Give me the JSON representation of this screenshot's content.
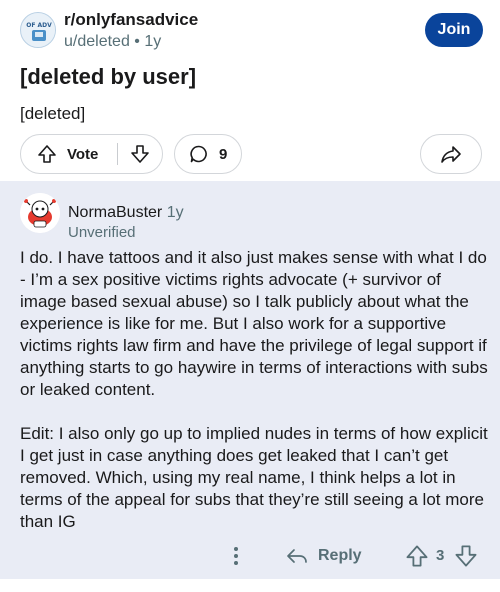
{
  "post": {
    "subreddit": "r/onlyfansadvice",
    "author_meta": "u/deleted • 1y",
    "join_label": "Join",
    "title": "[deleted by user]",
    "body": "[deleted]",
    "vote_label": "Vote",
    "comment_count": "9",
    "icons": [
      "subreddit-avatar",
      "upvote-icon",
      "downvote-icon",
      "comment-bubble-icon",
      "share-icon"
    ],
    "colors": {
      "join_bg": "#0a449b",
      "meta": "#576f76"
    }
  },
  "comment": {
    "author": "NormaBuster",
    "time": "1y",
    "flair": "Unverified",
    "paragraphs": [
      "I do. I have tattoos and it also just makes sense with what I do - I’m a sex positive victims rights advocate (+ survivor of image based sexual abuse) so I talk publicly about what the experience is like for me. But I also work for a supportive victims rights law firm and have the privilege of legal support if anything starts to go haywire in terms of interactions with subs or leaked content.",
      "Edit: I also only go up to implied nudes in terms of how explicit I get just in case anything does get leaked that I can’t get removed. Which, using my real name, I think helps a lot in terms of the appeal for subs that they’re still seeing a lot more than IG"
    ],
    "reply_label": "Reply",
    "score": "3",
    "icons": [
      "more-options-icon",
      "reply-arrow-icon",
      "upvote-icon",
      "downvote-icon",
      "snoo-avatar"
    ],
    "colors": {
      "background": "#e9ecf5"
    }
  }
}
